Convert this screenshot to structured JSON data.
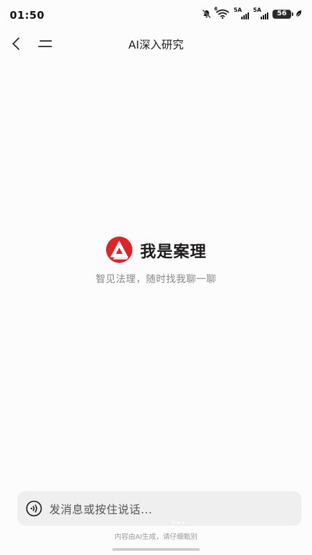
{
  "status_bar": {
    "time": "01:50",
    "network_1": "5A",
    "network_2": "5A",
    "wifi_tag": "6",
    "battery": "56"
  },
  "header": {
    "title": "AI深入研究"
  },
  "brand": {
    "name": "我是案理",
    "tagline": "智见法理，随时找我聊一聊"
  },
  "input": {
    "placeholder": "发消息或按住说话..."
  },
  "footer": {
    "disclaimer": "内容由AI生成，请仔细甄别"
  },
  "colors": {
    "brand_red": "#d9262b",
    "background": "#fcfcfc",
    "input_bg": "#efefef"
  },
  "icons": {
    "back": "chevron-left-icon",
    "menu": "menu-icon",
    "voice": "voice-wave-icon",
    "mute": "bell-off-icon",
    "wifi": "wifi-icon",
    "leaf": "leaf-icon"
  }
}
